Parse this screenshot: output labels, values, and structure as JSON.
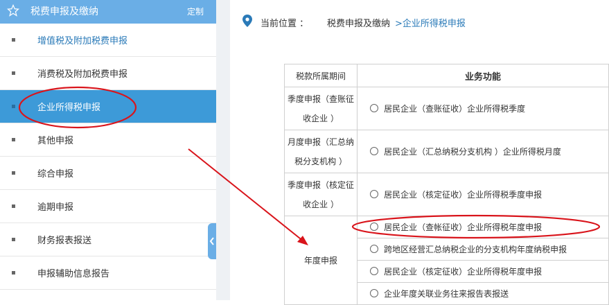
{
  "sidebar": {
    "title": "税费申报及缴纳",
    "customize": "定制",
    "items": [
      {
        "label": "增值税及附加税费申报"
      },
      {
        "label": "消费税及附加税费申报"
      },
      {
        "label": "企业所得税申报"
      },
      {
        "label": "其他申报"
      },
      {
        "label": "综合申报"
      },
      {
        "label": "逾期申报"
      },
      {
        "label": "财务报表报送"
      },
      {
        "label": "申报辅助信息报告"
      }
    ]
  },
  "breadcrumb": {
    "prefix": "当前位置 ：",
    "level1": "税费申报及缴纳",
    "level2": ">企业所得税申报"
  },
  "table": {
    "headers": [
      "税款所属期间",
      "业务功能"
    ],
    "rows": [
      {
        "period": "季度申报（查账征收企业 ）",
        "options": [
          "居民企业（查账征收）企业所得税季度"
        ]
      },
      {
        "period": "月度申报（汇总纳税分支机构 ）",
        "options": [
          "居民企业（汇总纳税分支机构 ）企业所得税月度"
        ]
      },
      {
        "period": "季度申报（核定征收企业 ）",
        "options": [
          "居民企业（核定征收）企业所得税季度申报"
        ]
      },
      {
        "period": "年度申报",
        "options": [
          "居民企业（查帐征收）企业所得税年度申报",
          "跨地区经营汇总纳税企业的分支机构年度纳税申报",
          "居民企业（核定征收）企业所得税年度申报",
          "企业年度关联业务往来报告表报送"
        ]
      }
    ]
  },
  "colors": {
    "header_blue": "#6aaee6",
    "active_blue": "#3d9ad8",
    "link_blue": "#2a7ab8",
    "annotation_red": "#d9141b"
  }
}
